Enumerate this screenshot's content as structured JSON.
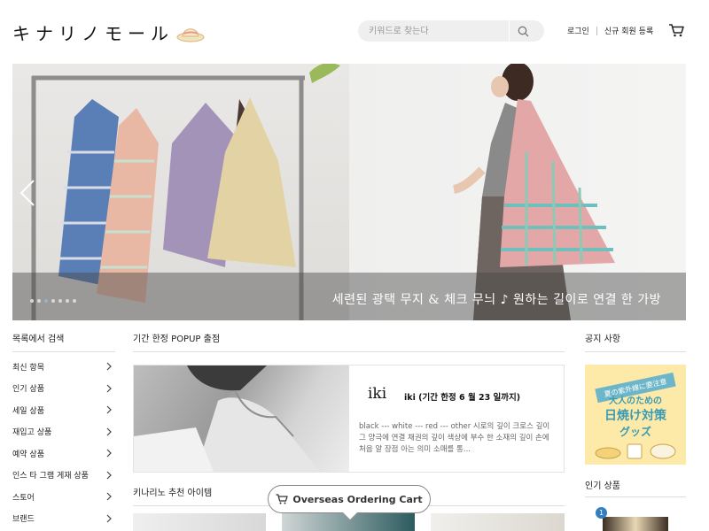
{
  "header": {
    "logo_text": "キナリノモール",
    "search_placeholder": "키워드로 찾는다",
    "login": "로그인",
    "signup": "신규 회원 등록"
  },
  "hero": {
    "caption": "세련된 광택 무지 & 체크 무늬 ♪ 원하는 길이로 연결 한 가방",
    "slide_count": 7,
    "active_slide_index": 2
  },
  "sidebar": {
    "title": "목록에서 검색",
    "items": [
      {
        "label": "최신 항목"
      },
      {
        "label": "인기 상품"
      },
      {
        "label": "세일 상품"
      },
      {
        "label": "재입고 상품"
      },
      {
        "label": "예약 상품"
      },
      {
        "label": "인스 타 그램 게재 상품"
      },
      {
        "label": "스토어"
      },
      {
        "label": "브랜드"
      }
    ]
  },
  "popup": {
    "section_title": "기간 한정 POPUP 출점",
    "brand": "iki",
    "title": "iki (기간 한정 6 월 23 일까지)",
    "description": "black --- white --- red --- other 시로의 깊이 크로스 깊이 그 양극에 연결 채권의 깊이 색상에 부수 한 소재의 깊이 손에 처음 알 장점 아는 의미 소매를 통..."
  },
  "recommend": {
    "section_title": "키나리노 추천 아이템"
  },
  "overseas_button": "Overseas Ordering Cart",
  "notice": {
    "section_title": "공지 사항",
    "banner_top": "夏の紫外線に要注意",
    "banner_line1": "大人のための",
    "banner_line2": "日焼け対策",
    "banner_line3": "グッズ"
  },
  "popular": {
    "section_title": "인기 상품",
    "rank": "1"
  },
  "colors": {
    "accent_blue": "#2f7fc1",
    "banner_bg": "#fde9a8",
    "banner_text": "#3b9bb3"
  }
}
